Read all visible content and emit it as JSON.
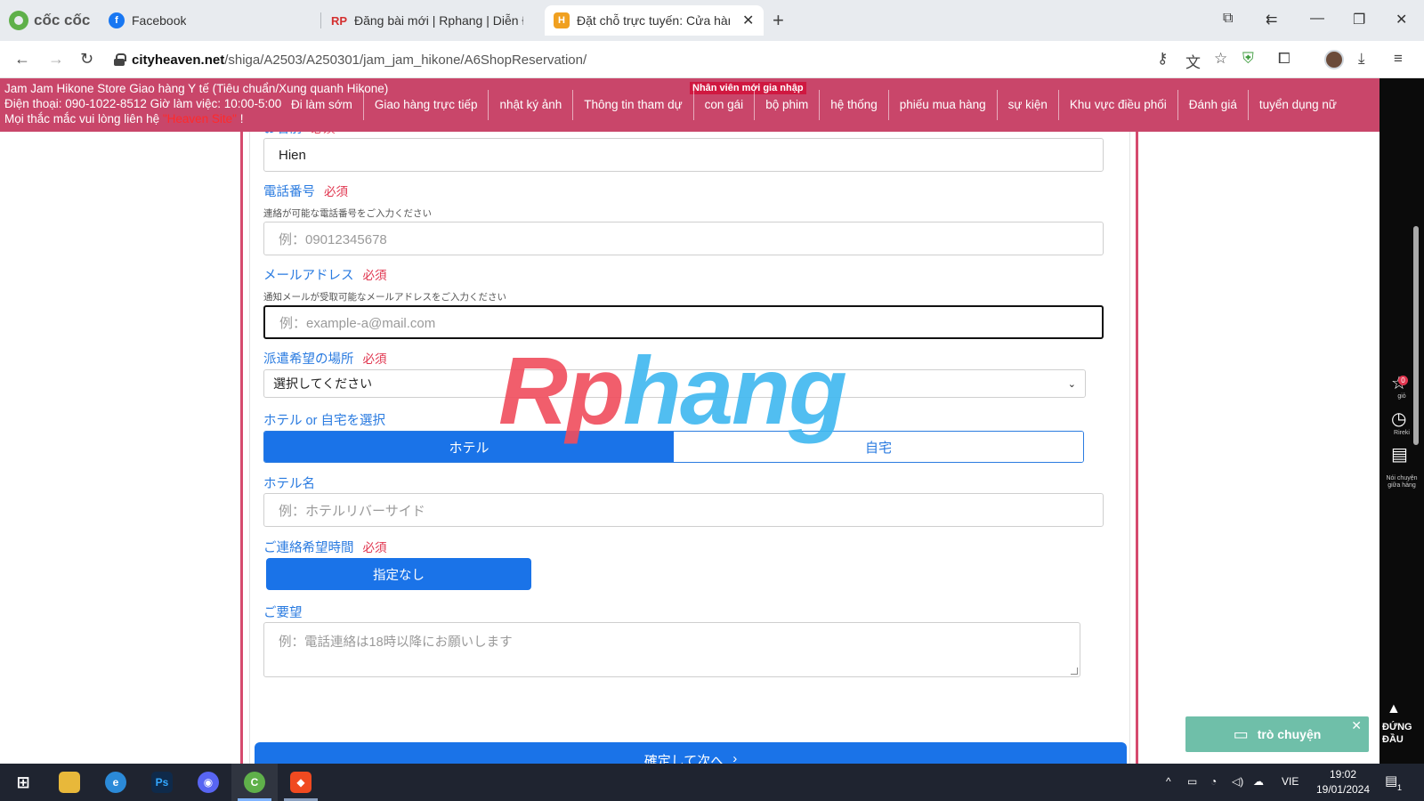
{
  "browser": {
    "brand": "cốc cốc",
    "tabs": [
      {
        "title": "Facebook",
        "icon": "facebook-icon",
        "color": "#1877f2"
      },
      {
        "title": "Đăng bài mới | Rphang | Diễn Đàn",
        "icon": "rphang-icon",
        "color": "#d43030",
        "fav_text": "RP"
      },
      {
        "title": "Đặt chỗ trực tuyến: Cửa hàng",
        "icon": "heaven-icon",
        "color": "#f0a020",
        "fav_text": "H",
        "active": true
      }
    ],
    "url_host": "cityheaven.net",
    "url_path": "/shiga/A2503/A250301/jam_jam_hikone/A6ShopReservation/"
  },
  "header": {
    "store_line1": "Jam Jam Hikone Store Giao hàng Y tế (Tiêu chuẩn/Xung quanh Hikone)",
    "store_line2": "Điện thoại: 090-1022-8512 Giờ làm việc: 10:00-5:00",
    "store_line3_pre": "Mọi thắc mắc vui lòng liên hệ ",
    "store_line3_link": "\"Heaven Site\"",
    "store_line3_post": " !",
    "new_badge": "Nhân viên mới gia nhập",
    "nav": [
      "Đi làm sớm",
      "Giao hàng trực tiếp",
      "nhật ký ảnh",
      "Thông tin tham dự",
      "con gái",
      "bộ phim",
      "hệ thống",
      "phiếu mua hàng",
      "sự kiện",
      "Khu vực điều phối",
      "Đánh giá",
      "tuyển dụng nữ"
    ]
  },
  "form": {
    "required": "必須",
    "name_label": "お名前",
    "name_value": "Hien",
    "phone_label": "電話番号",
    "phone_hint": "連絡が可能な電話番号をご入力ください",
    "phone_placeholder": "例：09012345678",
    "email_label": "メールアドレス",
    "email_hint": "通知メールが受取可能なメールアドレスをご入力ください",
    "email_placeholder": "例：example-a@mail.com",
    "place_label": "派遣希望の場所",
    "place_selected": "選択してください",
    "type_label": "ホテル or 自宅を選択",
    "type_hotel": "ホテル",
    "type_home": "自宅",
    "hotel_label": "ホテル名",
    "hotel_placeholder": "例：ホテルリバーサイド",
    "time_label": "ご連絡希望時間",
    "time_value": "指定なし",
    "request_label": "ご要望",
    "request_placeholder": "例：電話連絡は18時以降にお願いします",
    "submit": "確定して次へ"
  },
  "watermark": {
    "part1": "Rp",
    "part2": "hang"
  },
  "side": {
    "fav_label": "giỏ",
    "fav_count": "0",
    "history_label": "Rireki",
    "chat_label": "Nói chuyện giữa hàng",
    "top_label": "ĐỨNG ĐẦU",
    "chat_widget": "trò chuyện"
  },
  "taskbar": {
    "lang": "VIE",
    "time": "19:02",
    "date": "19/01/2024",
    "notif_count": "1"
  },
  "colors": {
    "accent": "#1a73e8",
    "header_pink": "#c9466a",
    "required_red": "#e0364f"
  }
}
